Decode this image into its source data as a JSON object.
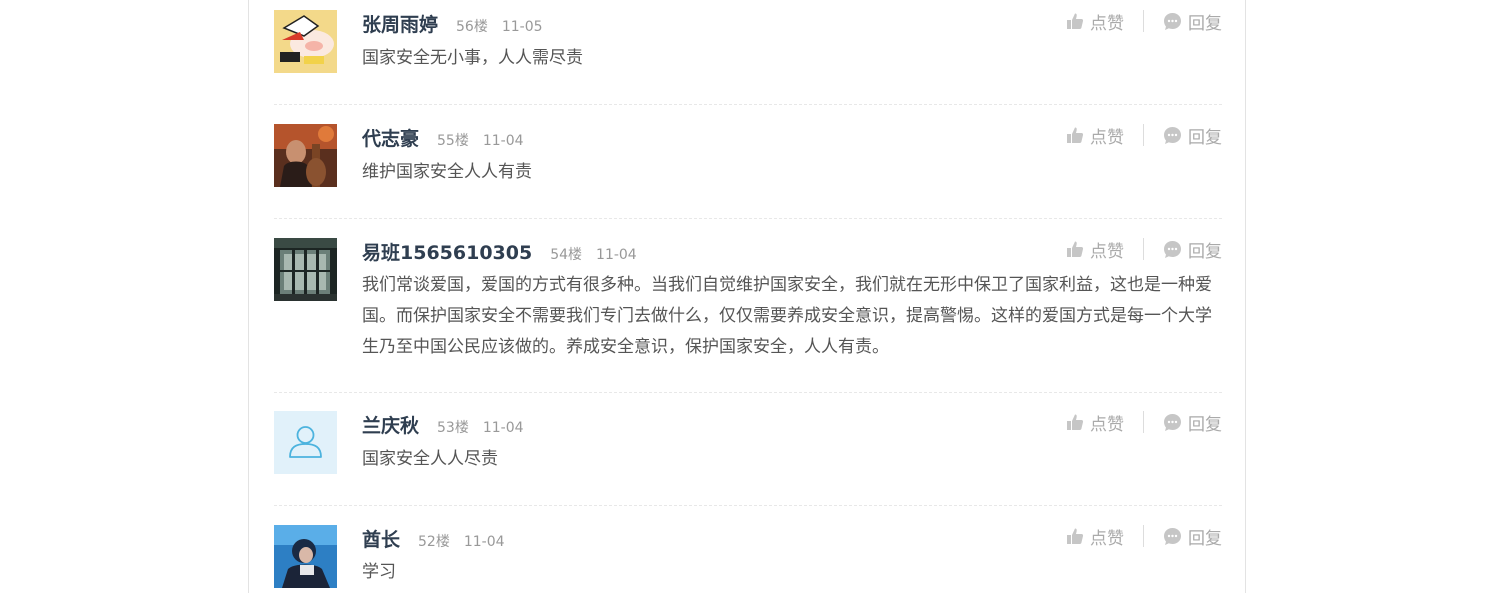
{
  "labels": {
    "like": "点赞",
    "reply": "回复"
  },
  "colors": {
    "username": "#2f3e50",
    "meta": "#999999",
    "body": "#555555",
    "action": "#aaaaaa"
  },
  "comments": [
    {
      "user": "张周雨婷",
      "floor": "56楼",
      "date": "11-05",
      "text": "国家安全无小事，人人需尽责",
      "avatar": "cartoon-avatar"
    },
    {
      "user": "代志豪",
      "floor": "55楼",
      "date": "11-04",
      "text": "维护国家安全人人有责",
      "avatar": "photo-avatar"
    },
    {
      "user": "易班1565610305",
      "floor": "54楼",
      "date": "11-04",
      "text": "我们常谈爱国，爱国的方式有很多种。当我们自觉维护国家安全，我们就在无形中保卫了国家利益，这也是一种爱国。而保护国家安全不需要我们专门去做什么，仅仅需要养成安全意识，提高警惕。这样的爱国方式是每一个大学生乃至中国公民应该做的。养成安全意识，保护国家安全，人人有责。",
      "avatar": "window-photo-avatar"
    },
    {
      "user": "兰庆秋",
      "floor": "53楼",
      "date": "11-04",
      "text": "国家安全人人尽责",
      "avatar": "default-user-avatar"
    },
    {
      "user": "酋长",
      "floor": "52楼",
      "date": "11-04",
      "text": "学习",
      "avatar": "blue-photo-avatar"
    }
  ]
}
